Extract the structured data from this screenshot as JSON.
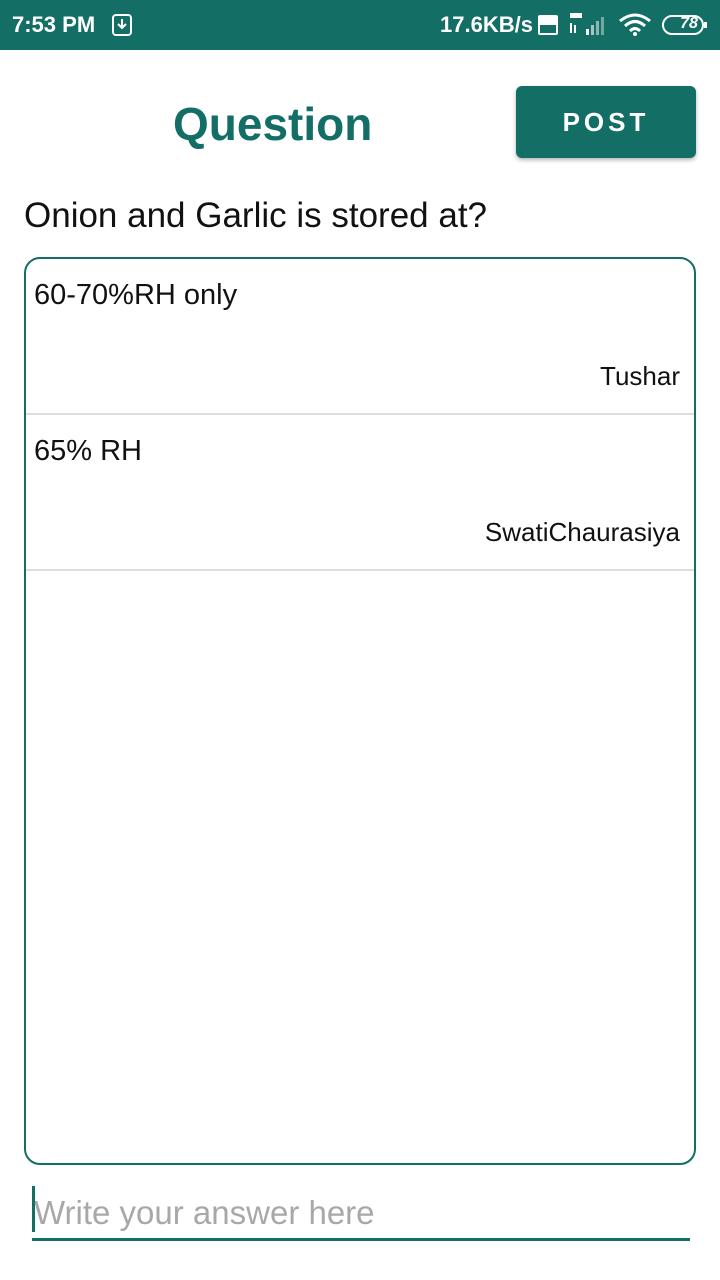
{
  "status_bar": {
    "time": "7:53 PM",
    "network_speed": "17.6KB/s",
    "battery_level": "78",
    "background_color": "#136e66",
    "icons": [
      "notification-icon",
      "volte-icon",
      "signal-4g-icon",
      "wifi-icon",
      "battery-icon"
    ]
  },
  "header": {
    "title": "Question",
    "post_label": "POST",
    "accent_color": "#136e66"
  },
  "question": {
    "text": "Onion and Garlic is stored at?"
  },
  "answers": [
    {
      "text": "60-70%RH only",
      "author": "Tushar"
    },
    {
      "text": "65% RH",
      "author": "SwatiChaurasiya"
    }
  ],
  "answer_input": {
    "value": "",
    "placeholder": "Write your answer here"
  }
}
